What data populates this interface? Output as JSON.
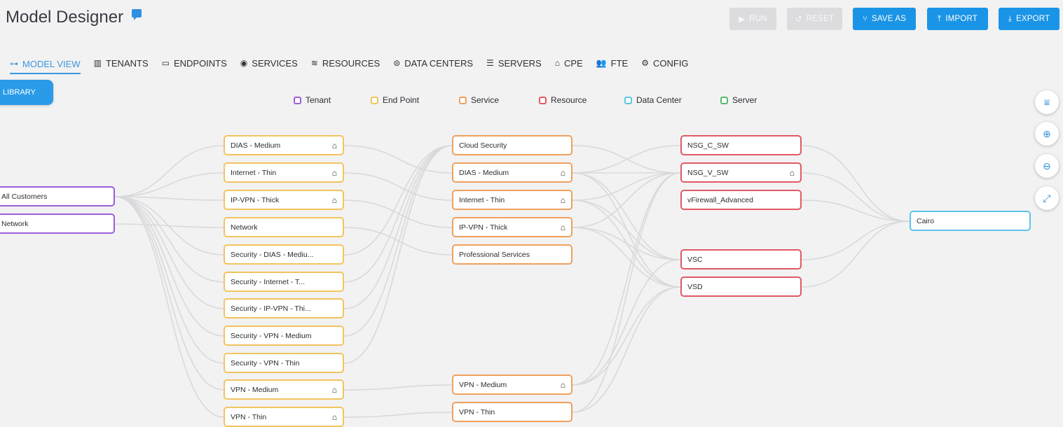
{
  "header": {
    "title": "Model Designer"
  },
  "toolbar": {
    "run": "RUN",
    "reset": "RESET",
    "save_as": "SAVE AS",
    "import": "IMPORT",
    "export": "EXPORT"
  },
  "tabs": [
    "MODEL VIEW",
    "TENANTS",
    "ENDPOINTS",
    "SERVICES",
    "RESOURCES",
    "DATA CENTERS",
    "SERVERS",
    "CPE",
    "FTE",
    "CONFIG"
  ],
  "library": "LIBRARY",
  "legend": [
    "Tenant",
    "End Point",
    "Service",
    "Resource",
    "Data Center",
    "Server"
  ],
  "colors": {
    "tenant": "#9c5fd6",
    "endpoint": "#f2c45d",
    "service": "#f0a05c",
    "resource": "#e05a63",
    "datacenter": "#5cc4e8",
    "server": "#55b96a",
    "accent": "#1a94e6"
  },
  "tenants": [
    "All Customers",
    "Network"
  ],
  "endpoints": [
    "DIAS - Medium",
    "Internet - Thin",
    "IP-VPN - Thick",
    "Network",
    "Security - DIAS - Mediu...",
    "Security - Internet - T...",
    "Security - IP-VPN - Thi...",
    "Security - VPN - Medium",
    "Security - VPN - Thin",
    "VPN - Medium",
    "VPN - Thin"
  ],
  "services": [
    "Cloud Security",
    "DIAS - Medium",
    "Internet - Thin",
    "IP-VPN - Thick",
    "Professional Services",
    "VPN - Medium",
    "VPN - Thin"
  ],
  "resources": [
    "NSG_C_SW",
    "NSG_V_SW",
    "vFirewall_Advanced",
    "VSC",
    "VSD"
  ],
  "datacenters": [
    "Cairo"
  ]
}
